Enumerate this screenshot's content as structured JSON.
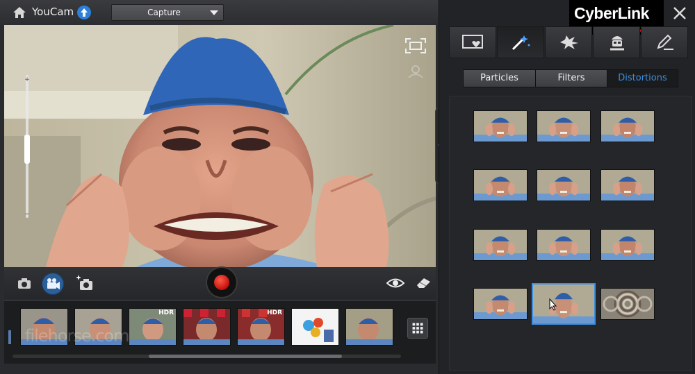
{
  "app": {
    "title": "YouCam",
    "brand": "CyberLink",
    "mode": "Capture"
  },
  "icons": {
    "home": "home-icon",
    "upgrade": "upgrade-arrow-icon",
    "dropdown": "chevron-down-icon",
    "fullscreen": "fullscreen-icon",
    "facetrack": "face-tracking-icon",
    "camera": "camera-icon",
    "video": "video-camera-icon",
    "snapshot": "camera-sparkle-icon",
    "record": "record-icon",
    "eye": "eye-icon",
    "eraser": "eraser-icon",
    "grid": "grid-icon",
    "close": "close-icon",
    "collapse": "chevron-left-icon"
  },
  "category_tabs": [
    {
      "id": "frames",
      "icon": "frame-heart-icon",
      "active": false
    },
    {
      "id": "magic",
      "icon": "magic-wand-icon",
      "active": true
    },
    {
      "id": "emotions",
      "icon": "splash-icon",
      "active": false
    },
    {
      "id": "avatars",
      "icon": "avatar-icon",
      "active": false
    },
    {
      "id": "drawing",
      "icon": "pen-icon",
      "active": false
    }
  ],
  "effect_tabs": [
    {
      "label": "Particles",
      "active": false
    },
    {
      "label": "Filters",
      "active": false
    },
    {
      "label": "Distortions",
      "active": true
    }
  ],
  "filmstrip": [
    {
      "badge": ""
    },
    {
      "badge": ""
    },
    {
      "badge": "HDR"
    },
    {
      "badge": ""
    },
    {
      "badge": "HDR"
    },
    {
      "badge": ""
    },
    {
      "badge": ""
    }
  ],
  "filmstrip_scroll": 0.5,
  "effects_selected_index": 10,
  "watermark": "filehorse.com",
  "colors": {
    "accent": "#3c8ee0",
    "record": "#d8150c",
    "brand_red": "#e0201a"
  }
}
